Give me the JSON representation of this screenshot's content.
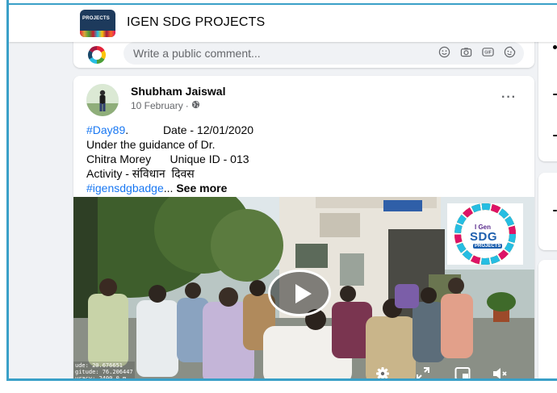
{
  "group": {
    "name": "IGEN SDG PROJECTS",
    "thumb_text": "PROJECTS"
  },
  "composer": {
    "placeholder": "Write a public comment..."
  },
  "post": {
    "author": "Shubham Jaiswal",
    "date": "10 February",
    "separator": "·",
    "privacy_icon": "globe-icon",
    "more_label": "···",
    "text": {
      "hashtag_day": "#Day89",
      "line1_rest": ".           Date - 12/01/2020",
      "line2": "Under the guidance of Dr.",
      "line3": "Chitra Morey      Unique ID - 013",
      "line4": "Activity - संविधान  दिवस",
      "hashtag_badge": "#igensdgbadge",
      "ellipsis": "... ",
      "see_more": "See more"
    },
    "video": {
      "geo_text": "ude: 20.676651\ngitude: 76.206447\nuracy: 2400.0 m",
      "logo_brand": "I Gen",
      "logo_sdg": "SDG",
      "logo_projects": "PROJECTS",
      "controls": [
        "settings-icon",
        "fullscreen-icon",
        "pip-icon",
        "mute-icon"
      ]
    }
  },
  "colors": {
    "accent_blue": "#1877f2",
    "frame_rule": "#3aa0c8",
    "feed_bg": "#f0f2f5"
  }
}
